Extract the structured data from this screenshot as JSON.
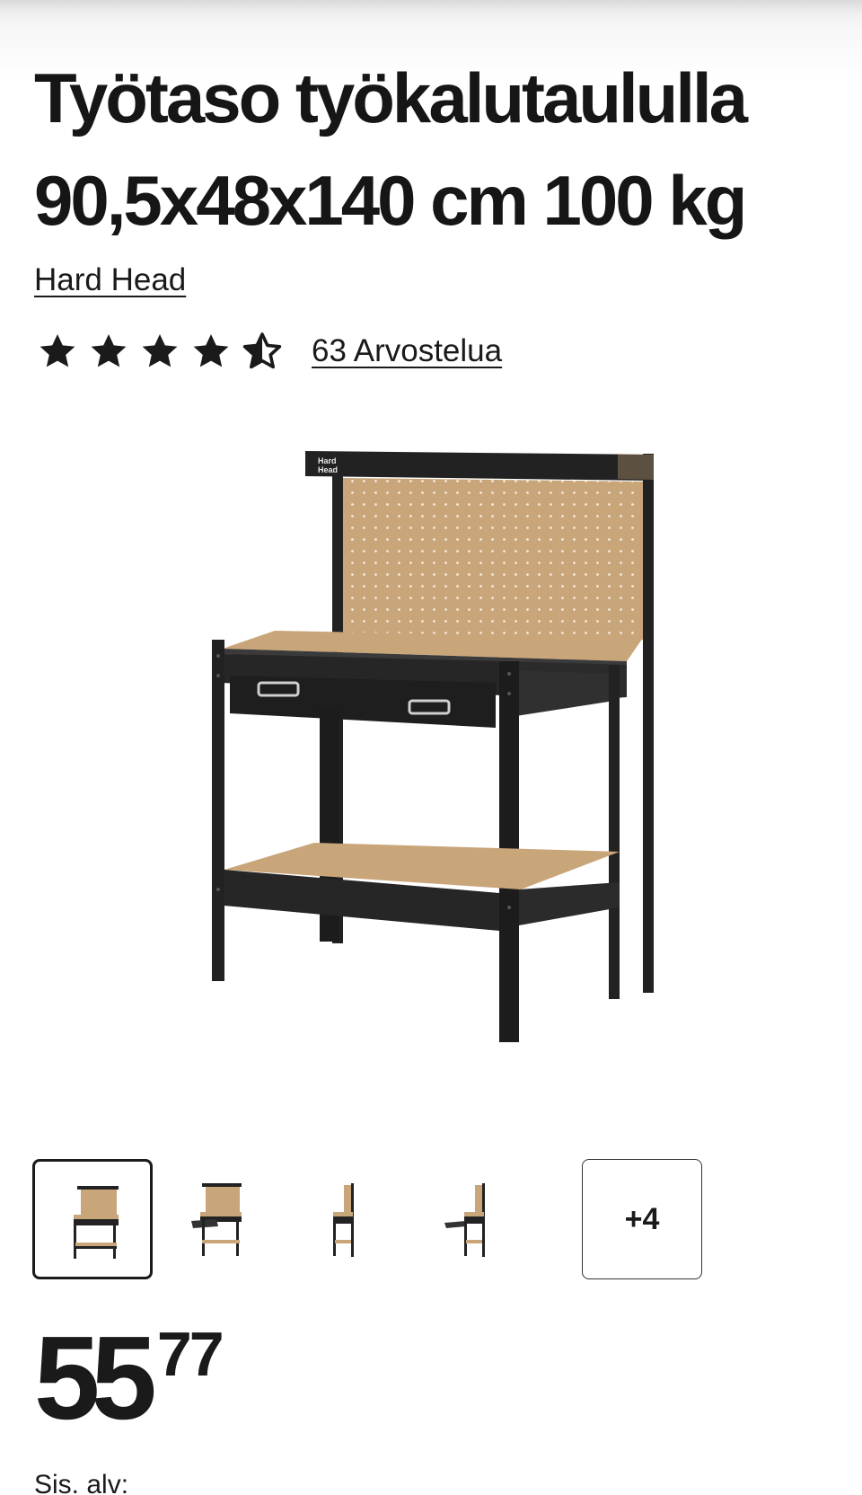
{
  "product": {
    "title": "Työtaso työkalutaululla 90,5x48x140 cm 100 kg",
    "brand": "Hard Head",
    "rating_value": 4.5,
    "rating_max": 5,
    "reviews_label": "63 Arvostelua",
    "image_brand_mark": "Hard Head"
  },
  "gallery": {
    "more_label": "+4",
    "thumbnail_count": 4,
    "selected_index": 0
  },
  "price": {
    "integer": "55",
    "decimals": "77",
    "vat_label": "Sis. alv:"
  },
  "colors": {
    "text": "#1a1a1a",
    "frame": "#222222",
    "board": "#c9a57a"
  },
  "icons": {
    "star_full": "star-icon",
    "star_half": "star-half-icon"
  }
}
